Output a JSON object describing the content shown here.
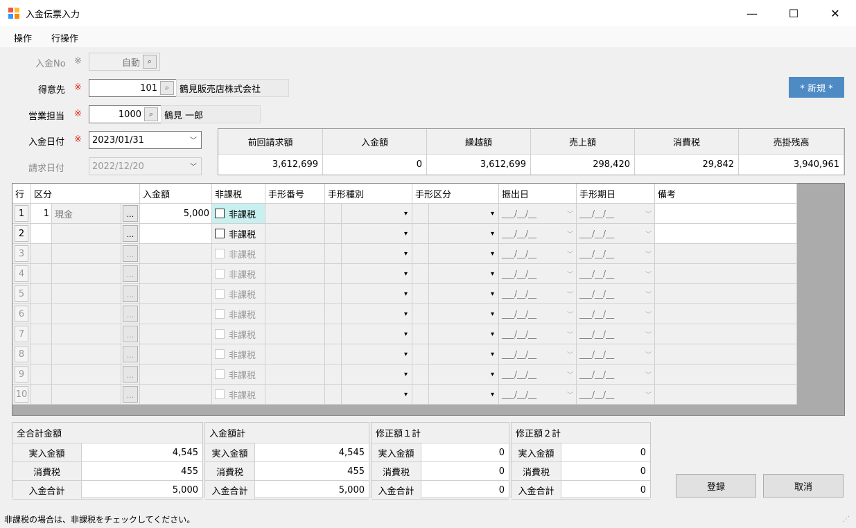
{
  "window": {
    "title": "入金伝票入力",
    "minimize": "—",
    "maximize": "☐",
    "close": "✕"
  },
  "menu": {
    "ops": "操作",
    "row_ops": "行操作"
  },
  "header": {
    "no_label": "入金No",
    "no_mark": "※",
    "no_value": "自動",
    "customer_label": "得意先",
    "customer_mark": "※",
    "customer_code": "101",
    "customer_name": "鶴見販売店株式会社",
    "staff_label": "営業担当",
    "staff_mark": "※",
    "staff_code": "1000",
    "staff_name": "鶴見 一郎",
    "date_label": "入金日付",
    "date_mark": "※",
    "date_value": "2023/01/31",
    "bill_date_label": "請求日付",
    "bill_date_value": "2022/12/20",
    "new_badge": "* 新規 *"
  },
  "summary": {
    "headers": [
      "前回請求額",
      "入金額",
      "繰越額",
      "売上額",
      "消費税",
      "売掛残高"
    ],
    "values": [
      "3,612,699",
      "0",
      "3,612,699",
      "298,420",
      "29,842",
      "3,940,961"
    ]
  },
  "grid": {
    "headers": {
      "row": "行",
      "kubun": "区分",
      "amount": "入金額",
      "taxfree": "非課税",
      "bill_no": "手形番号",
      "bill_type": "手形種別",
      "bill_kind": "手形区分",
      "issue_date": "振出日",
      "due_date": "手形期日",
      "note": "備考"
    },
    "ellipsis": "...",
    "checkbox_label": "非課税",
    "dropdown_glyph": "▾",
    "date_placeholder": "___/__/__",
    "date_glyph": "﹀",
    "rows": [
      {
        "no": "1",
        "code": "1",
        "name": "現金",
        "amount": "5,000"
      },
      {
        "no": "2",
        "code": "",
        "name": "",
        "amount": ""
      },
      {
        "no": "3",
        "code": "",
        "name": "",
        "amount": ""
      },
      {
        "no": "4",
        "code": "",
        "name": "",
        "amount": ""
      },
      {
        "no": "5",
        "code": "",
        "name": "",
        "amount": ""
      },
      {
        "no": "6",
        "code": "",
        "name": "",
        "amount": ""
      },
      {
        "no": "7",
        "code": "",
        "name": "",
        "amount": ""
      },
      {
        "no": "8",
        "code": "",
        "name": "",
        "amount": ""
      },
      {
        "no": "9",
        "code": "",
        "name": "",
        "amount": ""
      },
      {
        "no": "10",
        "code": "",
        "name": "",
        "amount": ""
      }
    ]
  },
  "totals": [
    {
      "title": "全合計金額",
      "rows": [
        {
          "k": "実入金額",
          "v": "4,545"
        },
        {
          "k": "消費税",
          "v": "455"
        },
        {
          "k": "入金合計",
          "v": "5,000"
        }
      ]
    },
    {
      "title": "入金額計",
      "rows": [
        {
          "k": "実入金額",
          "v": "4,545"
        },
        {
          "k": "消費税",
          "v": "455"
        },
        {
          "k": "入金合計",
          "v": "5,000"
        }
      ]
    },
    {
      "title": "修正額１計",
      "rows": [
        {
          "k": "実入金額",
          "v": "0"
        },
        {
          "k": "消費税",
          "v": "0"
        },
        {
          "k": "入金合計",
          "v": "0"
        }
      ]
    },
    {
      "title": "修正額２計",
      "rows": [
        {
          "k": "実入金額",
          "v": "0"
        },
        {
          "k": "消費税",
          "v": "0"
        },
        {
          "k": "入金合計",
          "v": "0"
        }
      ]
    }
  ],
  "buttons": {
    "register": "登録",
    "cancel": "取消"
  },
  "status": "非課税の場合は、非課税をチェックしてください。",
  "colors": {
    "badge": "#4e8bc4",
    "required": "#e03020",
    "checkbox_highlight": "#c8f0f0"
  }
}
